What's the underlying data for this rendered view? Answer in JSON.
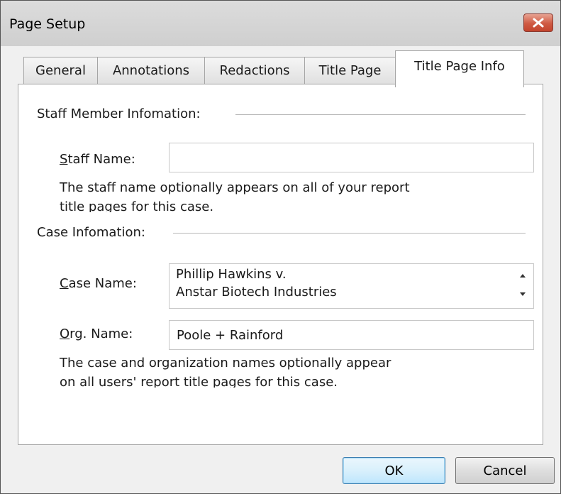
{
  "window": {
    "title": "Page Setup",
    "close_icon": "close-icon",
    "close_color": "#c7422c"
  },
  "tabs": [
    {
      "label": "General",
      "active": false
    },
    {
      "label": "Annotations",
      "active": false
    },
    {
      "label": "Redactions",
      "active": false
    },
    {
      "label": "Title Page",
      "active": false
    },
    {
      "label": "Title Page Info",
      "active": true
    }
  ],
  "staff_section": {
    "header": "Staff Member Infomation:",
    "staff_name": {
      "label_accel": "S",
      "label_rest": "taff Name:",
      "value": ""
    },
    "note_line1": "The staff name optionally appears on all of your report",
    "note_line2": "title pages for this case."
  },
  "case_section": {
    "header": "Case Infomation:",
    "case_name": {
      "label_accel": "C",
      "label_rest": "ase Name:",
      "value": "Phillip Hawkins v.\nAnstar Biotech Industries",
      "scroll_up_icon": "scroll-up-arrow-icon",
      "scroll_down_icon": "scroll-down-arrow-icon"
    },
    "org_name": {
      "label_accel": "O",
      "label_rest": "rg. Name:",
      "value": "Poole + Rainford"
    },
    "note_line1": "The case and organization names optionally appear",
    "note_line2": "on all users' report title pages for this case."
  },
  "buttons": {
    "ok": "OK",
    "cancel": "Cancel"
  }
}
